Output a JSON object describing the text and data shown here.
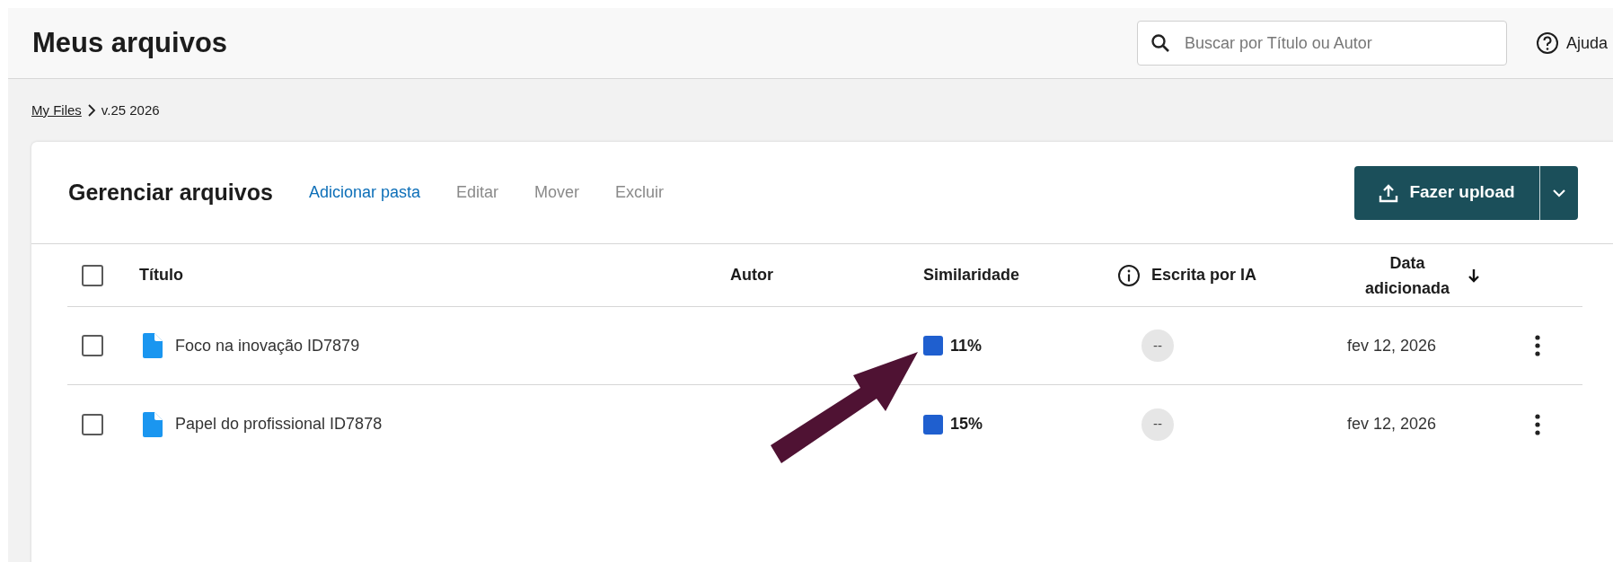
{
  "header": {
    "title": "Meus arquivos",
    "search": {
      "placeholder": "Buscar por Título ou Autor"
    },
    "help": "Ajuda"
  },
  "breadcrumb": [
    {
      "label": "My Files",
      "link": true
    },
    {
      "label": "v.25 2026",
      "link": false
    }
  ],
  "panel": {
    "title": "Gerenciar arquivos",
    "actions": [
      {
        "label": "Adicionar pasta",
        "disabled": false
      },
      {
        "label": "Editar",
        "disabled": true
      },
      {
        "label": "Mover",
        "disabled": true
      },
      {
        "label": "Excluir",
        "disabled": true
      }
    ],
    "upload_button": "Fazer upload",
    "table": {
      "select_all_checked": false,
      "columns": [
        {
          "label": "Título"
        },
        {
          "label": "Autor"
        },
        {
          "label": "Similaridade"
        },
        {
          "label": "Escrita por IA",
          "info": true
        },
        {
          "label": "Data adicionada",
          "sorted": true
        }
      ],
      "rows": [
        {
          "checked": false,
          "title": "Foco na inovação ID7879",
          "similarity": "11%",
          "color": "#1f5fcf",
          "ai": "--",
          "date": "fev 12, 2026"
        },
        {
          "checked": false,
          "title": "Papel do profissional ID7878",
          "similarity": "15%",
          "color": "#1f5fcf",
          "ai": "--",
          "date": "fev 12, 2026"
        }
      ]
    }
  },
  "annotation": {
    "kind": "arrow"
  }
}
